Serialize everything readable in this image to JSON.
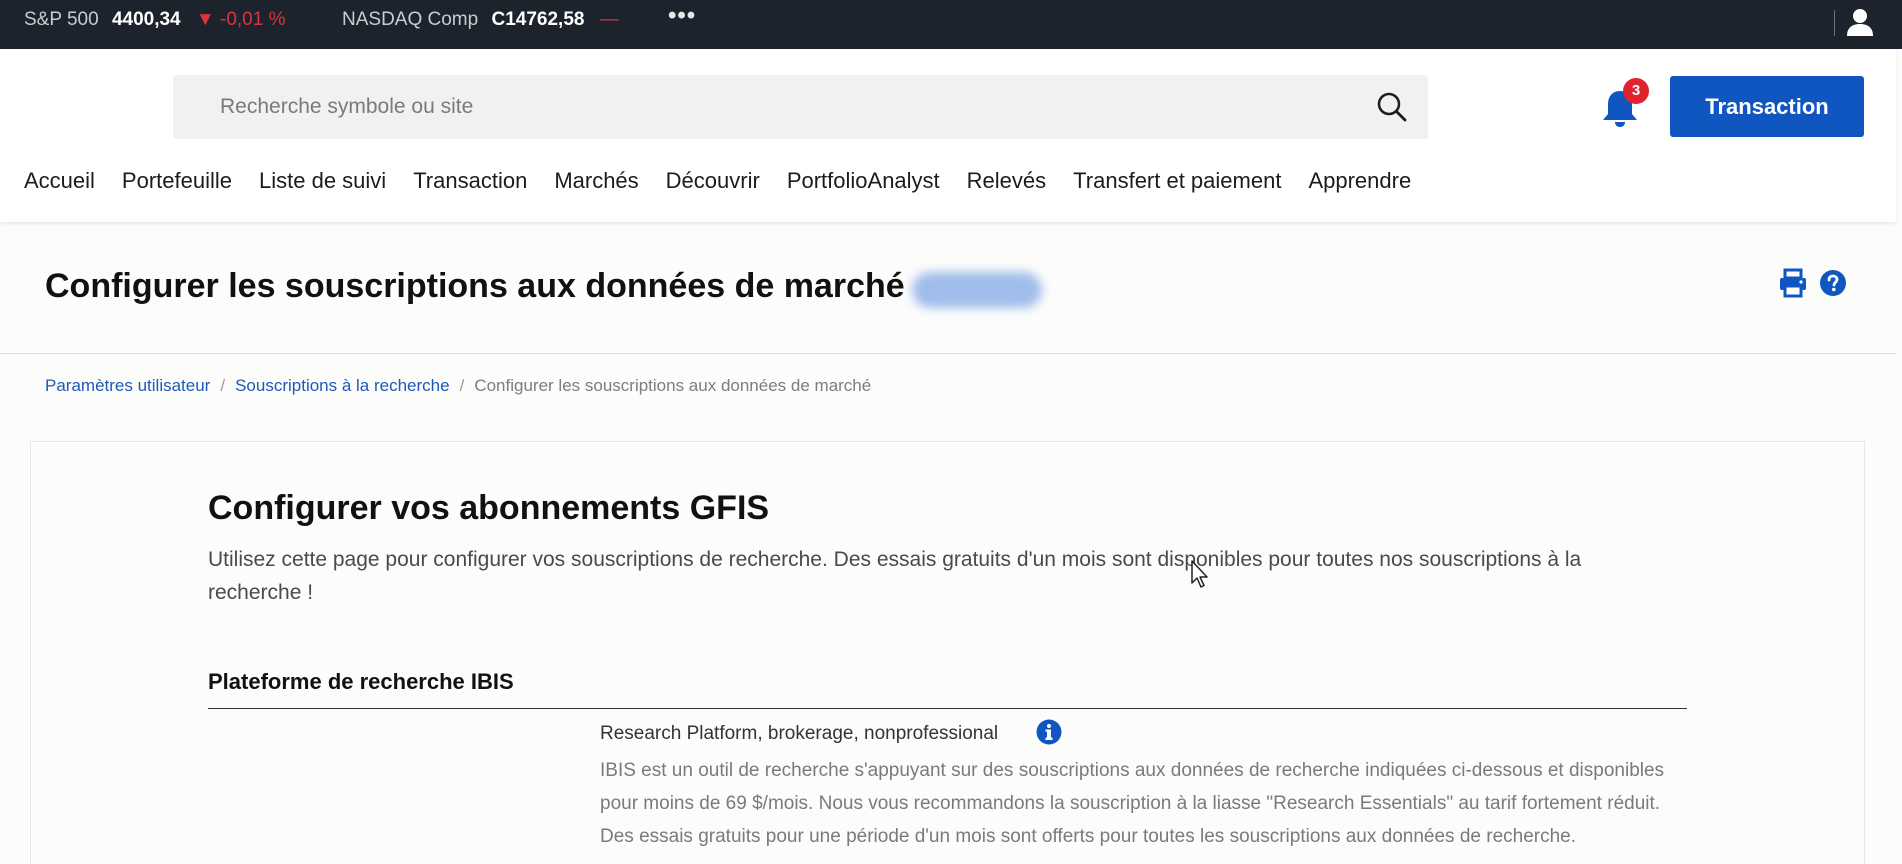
{
  "ticker": {
    "items": [
      {
        "name": "S&P 500",
        "value": "4400,34",
        "change": "▼ -0,01 %"
      },
      {
        "name": "NASDAQ Comp",
        "value": "C14762,58",
        "change": "—"
      }
    ],
    "more": "•••"
  },
  "header": {
    "search_placeholder": "Recherche symbole ou site",
    "notification_count": "3",
    "trade_button": "Transaction"
  },
  "nav": [
    "Accueil",
    "Portefeuille",
    "Liste de suivi",
    "Transaction",
    "Marchés",
    "Découvrir",
    "PortfolioAnalyst",
    "Relevés",
    "Transfert et paiement",
    "Apprendre"
  ],
  "page": {
    "title": "Configurer les souscriptions aux données de marché"
  },
  "breadcrumb": {
    "items": [
      "Paramètres utilisateur",
      "Souscriptions à la recherche"
    ],
    "current": "Configurer les souscriptions aux données de marché",
    "separator": "/"
  },
  "content": {
    "heading": "Configurer vos abonnements GFIS",
    "intro": "Utilisez cette page pour configurer vos souscriptions de recherche. Des essais gratuits d'un mois sont disponibles pour toutes nos souscriptions à la recherche !",
    "section_title": "Plateforme de recherche IBIS",
    "product_name": "Research Platform, brokerage, nonprofessional",
    "product_desc": "IBIS est un outil de recherche s'appuyant sur des souscriptions aux données de recherche indiquées ci-dessous et disponibles pour moins de 69 $/mois. Nous vous recommandons la souscription à la liasse \"Research Essentials\" au tarif fortement réduit. Des essais gratuits pour une période d'un mois sont offerts pour toutes les souscriptions aux données de recherche."
  },
  "colors": {
    "ticker_bg": "#1d232c",
    "brand_blue": "#0f56c1",
    "negative": "#e0323b",
    "badge_red": "#e0232e",
    "link": "#1f59b8"
  }
}
